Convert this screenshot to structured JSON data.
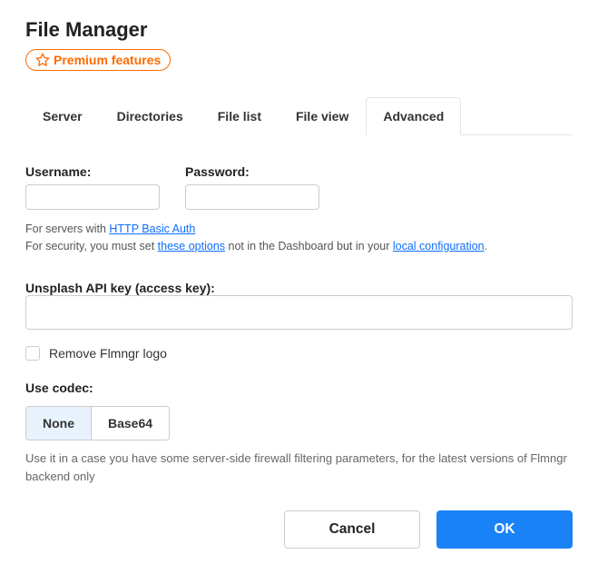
{
  "title": "File Manager",
  "premium_label": "Premium features",
  "tabs": [
    {
      "label": "Server"
    },
    {
      "label": "Directories"
    },
    {
      "label": "File list"
    },
    {
      "label": "File view"
    },
    {
      "label": "Advanced"
    }
  ],
  "username_label": "Username:",
  "username_value": "",
  "password_label": "Password:",
  "password_value": "",
  "helper_auth_prefix": "For servers with ",
  "helper_auth_link": "HTTP Basic Auth",
  "helper_security_prefix": "For security, you must set ",
  "helper_security_link1": "these options",
  "helper_security_mid": " not in the Dashboard but in your ",
  "helper_security_link2": "local configuration",
  "helper_security_suffix": ".",
  "unsplash_label": "Unsplash API key (access key):",
  "unsplash_value": "",
  "remove_logo_label": "Remove Flmngr logo",
  "remove_logo_checked": false,
  "codec_label": "Use codec:",
  "codec_options": [
    "None",
    "Base64"
  ],
  "codec_selected": "None",
  "codec_helper": "Use it in a case you have some server-side firewall filtering parameters, for the latest versions of Flmngr backend only",
  "cancel_label": "Cancel",
  "ok_label": "OK"
}
